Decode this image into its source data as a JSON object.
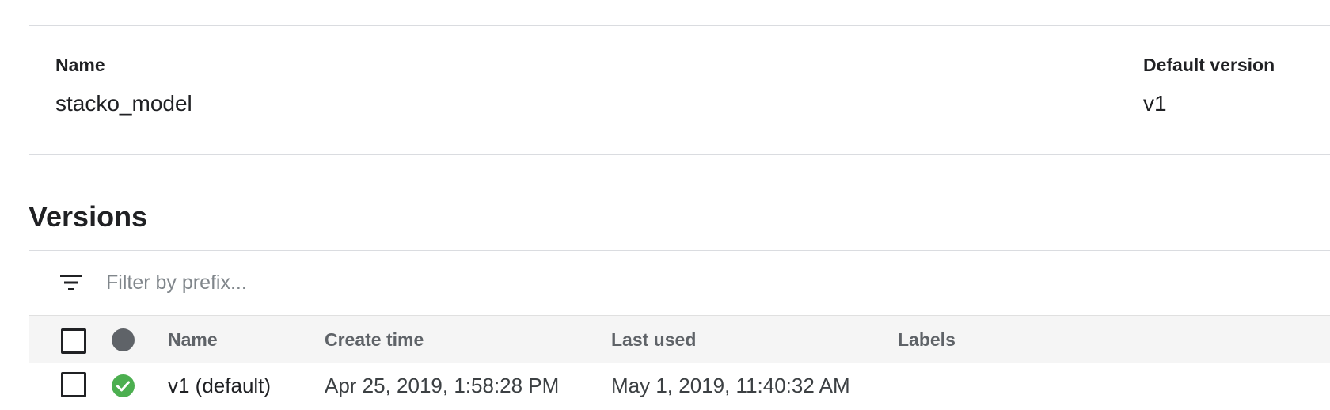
{
  "details": {
    "name_label": "Name",
    "name_value": "stacko_model",
    "default_version_label": "Default version",
    "default_version_value": "v1"
  },
  "versions": {
    "title": "Versions",
    "filter": {
      "icon": "filter-list-icon",
      "placeholder": "Filter by prefix...",
      "value": ""
    },
    "table": {
      "columns": {
        "select_all": "checkbox",
        "status": "status-icon",
        "name": "Name",
        "create_time": "Create time",
        "last_used": "Last used",
        "labels": "Labels"
      },
      "rows": [
        {
          "selected": false,
          "status": "ready",
          "status_icon": "check-circle-icon",
          "name": "v1 (default)",
          "create_time": "Apr 25, 2019, 1:58:28 PM",
          "last_used": "May 1, 2019, 11:40:32 AM",
          "labels": ""
        }
      ]
    }
  },
  "colors": {
    "status_ok": "#4caf50",
    "header_bg": "#f5f5f5",
    "border": "#dadce0",
    "header_text": "#5f6368"
  }
}
